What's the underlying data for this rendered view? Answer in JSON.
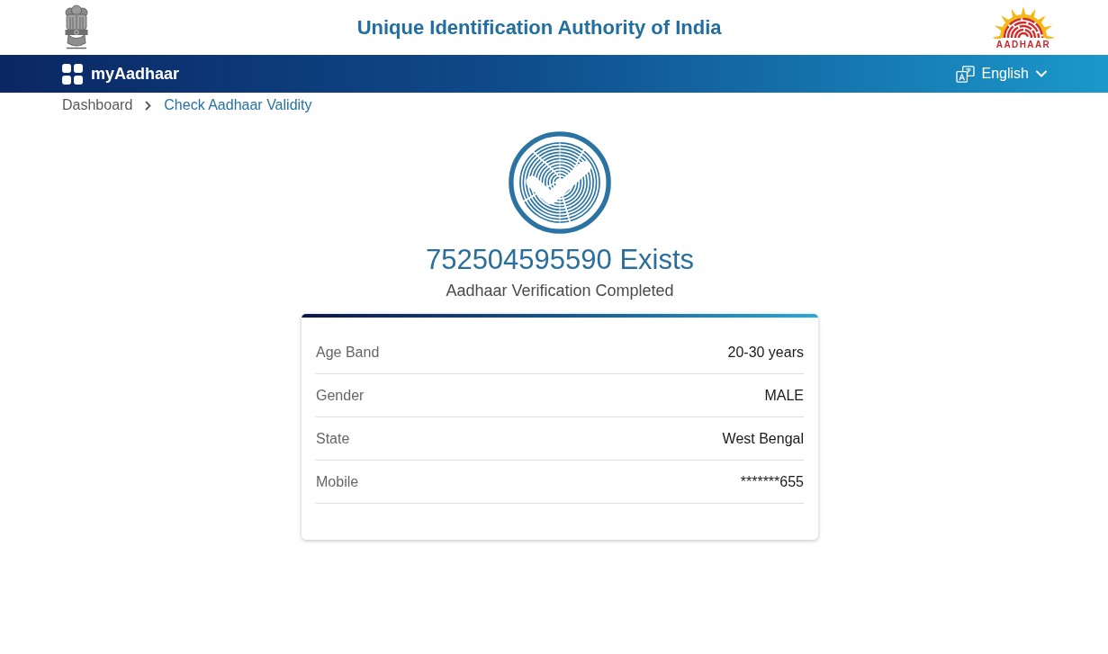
{
  "header": {
    "title": "Unique Identification Authority of India",
    "logo_text": "AADHAAR"
  },
  "navbar": {
    "brand": "myAadhaar",
    "language": "English"
  },
  "breadcrumb": [
    {
      "label": "Dashboard",
      "current": false
    },
    {
      "label": "Check Aadhaar Validity",
      "current": true
    }
  ],
  "result": {
    "heading": "752504595590 Exists",
    "subheading": "Aadhaar Verification Completed"
  },
  "details": [
    {
      "label": "Age Band",
      "value": "20-30 years"
    },
    {
      "label": "Gender",
      "value": "MALE"
    },
    {
      "label": "State",
      "value": "West Bengal"
    },
    {
      "label": "Mobile",
      "value": "*******655"
    }
  ]
}
